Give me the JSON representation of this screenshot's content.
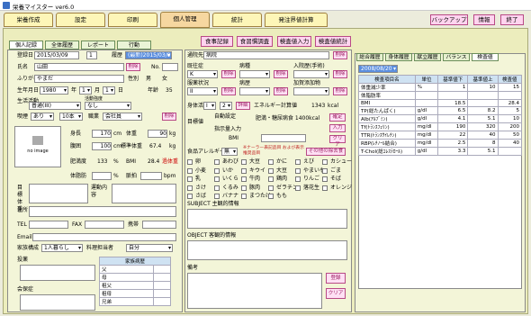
{
  "title": "栄養マイスター ver6.0",
  "menu": [
    "栄養作成",
    "設定",
    "印刷",
    "個人管理",
    "統計",
    "発注界値計算"
  ],
  "top_buttons": [
    "バックアップ",
    "情報",
    "終了"
  ],
  "subtabs": [
    "個人記録",
    "全体履歴",
    "レポート",
    "行動"
  ],
  "action_buttons": [
    "食事記録",
    "食習慣調査",
    "検査値入力",
    "検査値統計"
  ],
  "left": {
    "reg_date_label": "登録日",
    "reg_date": "2015/03/09",
    "count": "1",
    "history_label": "履歴",
    "history_date": "(最新)2015/03/09",
    "name_label": "氏名",
    "name": "山田",
    "delete": "削除",
    "no_label": "No.",
    "kana_label": "ふりがな",
    "kana": "やまだ",
    "sex_label": "性別",
    "male": "男",
    "female": "女",
    "birth_label": "生年月日",
    "birth_year": "1980",
    "year_u": "年",
    "birth_month": "1",
    "month_u": "月",
    "birth_day": "1",
    "day_u": "日",
    "age_label": "年齢",
    "age": "35",
    "activity_label": "生活活動",
    "activity_level": "活動強度",
    "activity": "普通(III)",
    "intensity": "なし",
    "drink_label": "喫煙",
    "drink": "あり",
    "cig": "10本",
    "job_label": "職業",
    "job": "会社員",
    "noimage": "no image",
    "height_label": "身長",
    "height": "170",
    "height_u": "cm",
    "weight_label": "体重",
    "weight": "90",
    "weight_u": "kg",
    "waist_label": "腹囲",
    "waist": "100",
    "waist_u": "cm",
    "stdwt_label": "標準体重",
    "stdwt": "67.4",
    "stdwt_u": "kg",
    "obesity_label": "肥満度",
    "obesity": "133",
    "obesity_u": "%",
    "bmi_label": "BMI",
    "bmi": "28.4",
    "bmi_status": "過体重",
    "fat_label": "体脂肪",
    "fat_u": "%",
    "pulse_label": "脈拍",
    "pulse_u": "bpm",
    "goal_label": "目標体重",
    "exercise_label": "運動内容",
    "address_label": "住所",
    "tel_label": "TEL",
    "fax_label": "FAX",
    "mobile_label": "携帯",
    "email_label": "Email",
    "family_label": "家族構成",
    "family": "1人暮らし",
    "cook_label": "料理担当者",
    "cook": "自分",
    "meds_label": "投薬",
    "meeting_label": "会保症",
    "disease_header": "家族病歴",
    "disease_rows": [
      "父",
      "母",
      "祖父",
      "祖母",
      "兄弟"
    ]
  },
  "mid": {
    "hospital_label": "通院先",
    "hospital": "病院",
    "disease_label": "既往症",
    "disease_label2": "病種",
    "hospitalized_label": "入院歴(手術)",
    "disease_sel": "K",
    "family_hist_label": "家族歴",
    "med_label": "服薬状況",
    "med_sel": "II",
    "history_label": "病歴",
    "supplement_label": "加賀添加物",
    "activity_label": "身体活動",
    "lvl": "I",
    "lvl2": "2",
    "detail": "詳細",
    "energy_label": "エネルギー計算値",
    "energy": "1343",
    "energy_u": "kcal",
    "target_label": "目標値",
    "auto": "自動設定",
    "manual": "指示量入力",
    "energy_target": "肥満・糖尿病食 1400kcal",
    "confirm": "確定",
    "input": "入力",
    "bmi_label": "BMI",
    "clear": "クリア",
    "allergy_label": "食品アレルギー",
    "allergy_sel": "無",
    "allergy_note": "※ナーラー表記品目 および表示推奨品目",
    "other": "その他の除去食",
    "allergens": [
      "卵",
      "あわび",
      "大豆",
      "かに",
      "えび",
      "カシュー",
      "小麦",
      "いか",
      "キウイ",
      "大豆",
      "やまいも",
      "ごま",
      "乳",
      "いくら",
      "牛肉",
      "鶏肉",
      "りんご",
      "そば",
      "さけ",
      "くるみ",
      "豚肉",
      "ゼラチン",
      "落花生",
      "オレンジ",
      "さば",
      "バナナ",
      "まつたけ",
      "もも"
    ],
    "subject_label": "SUBJECT 主観的情報",
    "object_label": "OBJECT 客観的情報",
    "remarks_label": "備考",
    "register": "登録",
    "clear2": "クリア"
  },
  "right": {
    "tabs": [
      "総合履歴",
      "身体履歴",
      "献立履歴",
      "バランス",
      "検査値"
    ],
    "date": "2008/08/20",
    "columns": [
      "検査項目名",
      "単位",
      "基準値下",
      "基準値上",
      "検査値"
    ],
    "rows": [
      [
        "体重減少率",
        "%",
        "1",
        "10",
        "15"
      ],
      [
        "体脂肪率",
        "",
        "",
        "",
        ""
      ],
      [
        "BMI",
        "",
        "18.5",
        "",
        "28.4"
      ],
      [
        "TP(総たんぱく)",
        "g/dl",
        "6.5",
        "8.2",
        "5"
      ],
      [
        "Alb(ｱﾙﾌﾞﾐﾝ)",
        "g/dl",
        "4.1",
        "5.1",
        "10"
      ],
      [
        "Tf(ﾄﾗﾝｽﾌｪﾘﾝ)",
        "mg/dl",
        "190",
        "320",
        "200"
      ],
      [
        "TTR(ﾄﾗﾝｽｻｲﾚﾁﾝ)",
        "mg/dl",
        "22",
        "40",
        "50"
      ],
      [
        "RBP(ﾚﾁﾉｰﾙ結合)",
        "mg/dl",
        "2.5",
        "8",
        "40"
      ],
      [
        "T-Chol(総ｺﾚｽﾃﾛｰﾙ)",
        "g/dl",
        "3.3",
        "5.1",
        ""
      ]
    ]
  },
  "colors": {
    "accent": "#ffd4ef",
    "panel": "#ecedbd",
    "menu": "#fdf6b8"
  }
}
